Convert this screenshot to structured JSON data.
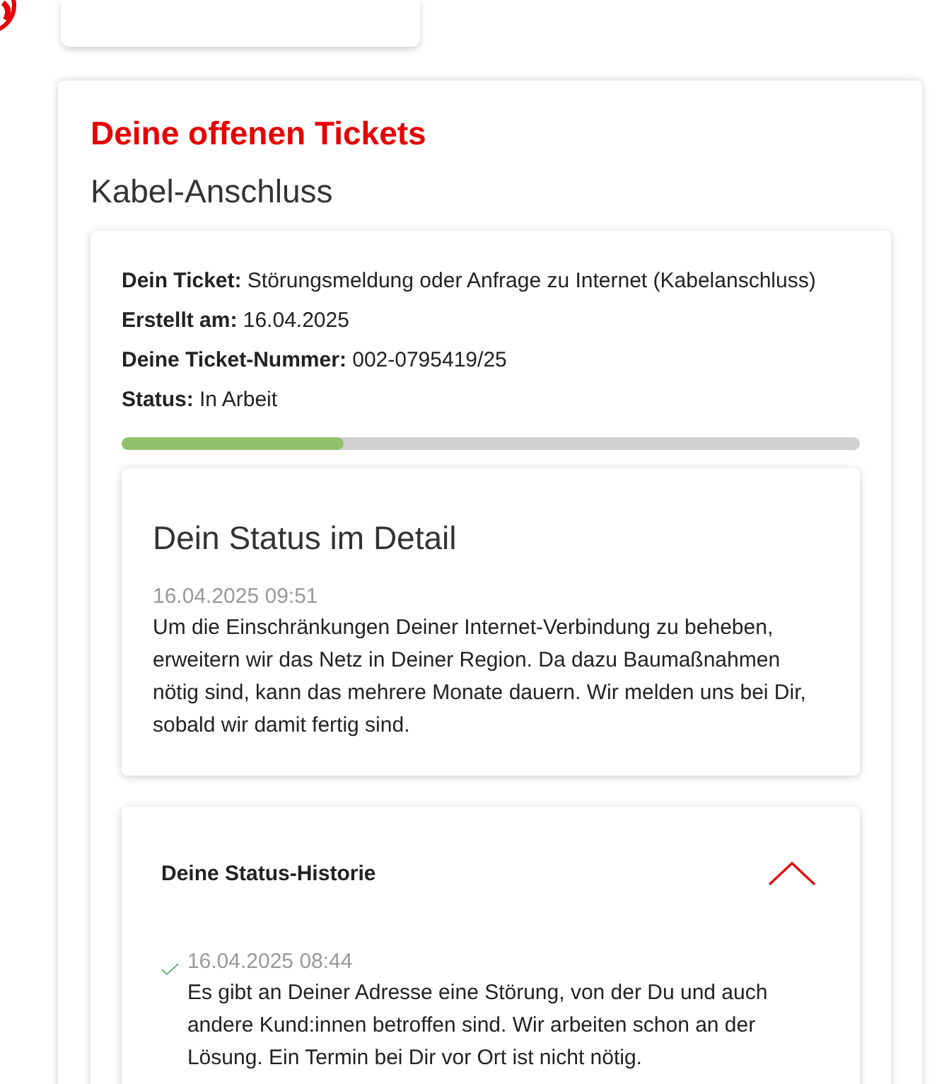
{
  "title": "Deine offenen Tickets",
  "section": "Kabel-Anschluss",
  "ticket_info": [
    "**Dein Ticket:** Störungsmeldung oder Anfrage zu Internet (Kabelanschluss)",
    "**Erstellt am:** 16.04.2025",
    "**Deine Ticket-Nummer:** 002-0795419/25",
    "**Status:** In Arbeit"
  ],
  "progress": {
    "level": 0.3
  },
  "detail": {
    "heading": "Dein Status im Detail",
    "time": "16.04.2025 09:51",
    "text": "Um die Einschränkungen Deiner Internet-Verbindung zu beheben, erweitern wir das Netz in Deiner Region. Da dazu Baumaßnahmen nötig sind, kann das mehrere Monate dauern. Wir melden uns bei Dir, sobald wir damit fertig sind."
  },
  "history": {
    "heading": "Deine Status-Historie",
    "expanded": true,
    "items": [
      {
        "time": "16.04.2025 08:44",
        "done": true,
        "text": "Es gibt an Deiner Adresse eine Störung, von der Du und auch andere Kund:innen betroffen sind. Wir arbeiten schon an der Lösung. Ein Termin bei Dir vor Ort ist nicht nötig."
      }
    ]
  }
}
